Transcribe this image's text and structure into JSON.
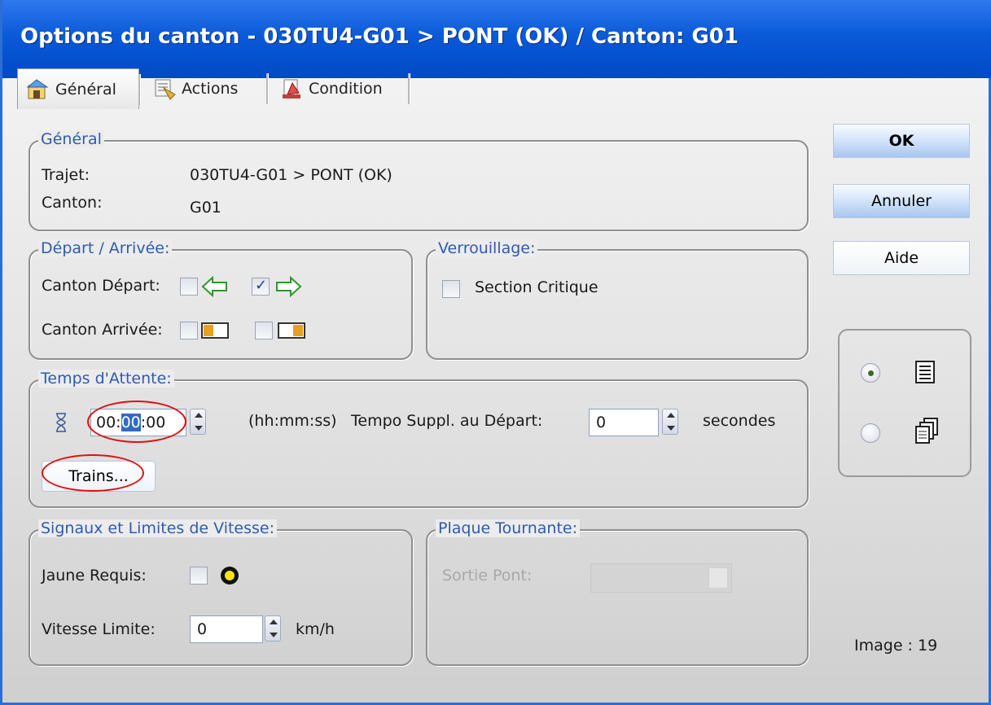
{
  "window": {
    "title": "Options du canton - 030TU4-G01 > PONT (OK) / Canton: G01"
  },
  "tabs": [
    {
      "label": "Général",
      "icon": "general-icon"
    },
    {
      "label": "Actions",
      "icon": "actions-icon"
    },
    {
      "label": "Condition",
      "icon": "condition-icon"
    }
  ],
  "general": {
    "legend": "Général",
    "trajet_label": "Trajet:",
    "trajet_value": "030TU4-G01 > PONT (OK)",
    "canton_label": "Canton:",
    "canton_value": "G01"
  },
  "depart": {
    "legend": "Départ / Arrivée:",
    "canton_depart_label": "Canton Départ:",
    "canton_arrivee_label": "Canton Arrivée:",
    "depart_left_checked": false,
    "depart_right_checked": true,
    "arrivee_left_checked": false,
    "arrivee_right_checked": false
  },
  "verrouillage": {
    "legend": "Verrouillage:",
    "section_critique_label": "Section Critique",
    "section_critique_checked": false
  },
  "attente": {
    "legend": "Temps d'Attente:",
    "time_hh": "00:",
    "time_mm": "00",
    "time_ss": ":00",
    "format_label": "(hh:mm:ss)",
    "tempo_label": "Tempo Suppl. au Départ:",
    "tempo_value": "0",
    "seconds_label": "secondes",
    "trains_button": "Trains..."
  },
  "signaux": {
    "legend": "Signaux et Limites de Vitesse:",
    "jaune_label": "Jaune Requis:",
    "jaune_checked": false,
    "vitesse_label": "Vitesse Limite:",
    "vitesse_value": "0",
    "vitesse_unit": "km/h"
  },
  "plaque": {
    "legend": "Plaque Tournante:",
    "sortie_label": "Sortie Pont:"
  },
  "buttons": {
    "ok": "OK",
    "cancel": "Annuler",
    "help": "Aide"
  },
  "view_mode": {
    "selected": "list"
  },
  "status": {
    "image_label": "Image : 19"
  },
  "colors": {
    "title_bar": "#0a5ad8",
    "legend_text": "#2e5bb0",
    "highlight_ring": "#e01010",
    "selection": "#316ac5"
  }
}
